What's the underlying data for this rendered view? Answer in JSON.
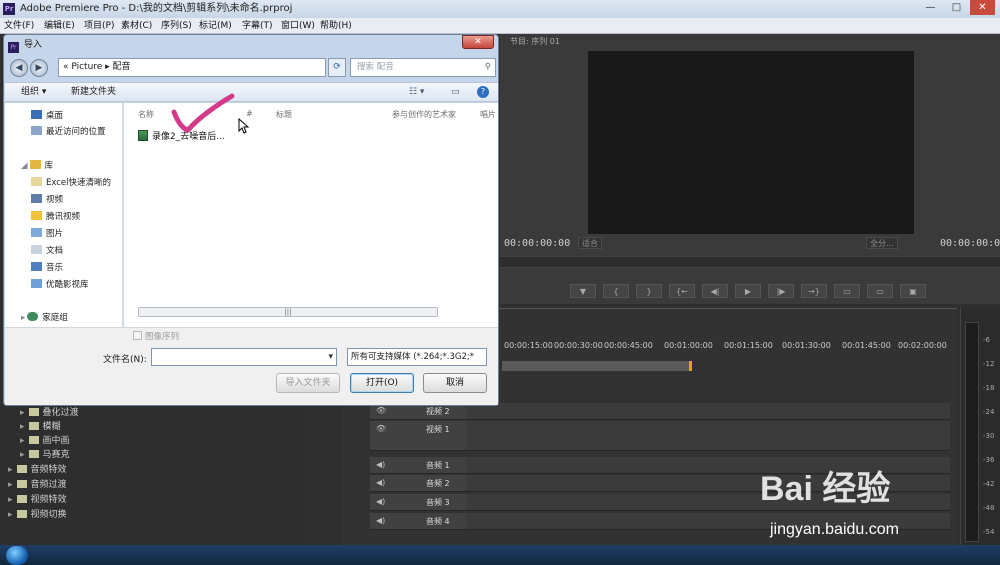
{
  "app": {
    "title": "Adobe Premiere Pro - D:\\我的文档\\剪辑系列\\未命名.prproj",
    "icon": "Pr",
    "window_controls": [
      "—",
      "□",
      "✕"
    ]
  },
  "menu": [
    "文件(F)",
    "编辑(E)",
    "项目(P)",
    "素材(C)",
    "序列(S)",
    "标记(M)",
    "字幕(T)",
    "窗口(W)",
    "帮助(H)"
  ],
  "monitor": {
    "tab": "节目: 序列 01",
    "timecode_left": "00:00:00:00",
    "fit_label": "适合",
    "full_label": "全分...",
    "timecode_right": "00:00:00:00",
    "controls": [
      "▼",
      "{",
      "}",
      "{←",
      "◀|",
      "▶",
      "|▶",
      "→}",
      "▭",
      "▭",
      "▣"
    ]
  },
  "timeline": {
    "ruler": [
      "00:00:15:00",
      "00:00:30:00",
      "00:00:45:00",
      "00:01:00:00",
      "00:01:15:00",
      "00:01:30:00",
      "00:01:45:00",
      "00:02:00:00"
    ],
    "tracks": [
      {
        "label": "视频 2",
        "icon": "👁"
      },
      {
        "label": "视频 1",
        "icon": "👁"
      },
      {
        "label": "音频 1",
        "icon": "◀)"
      },
      {
        "label": "音频 2",
        "icon": "◀)"
      },
      {
        "label": "音频 3",
        "icon": "◀)"
      },
      {
        "label": "音频 4",
        "icon": "◀)"
      }
    ]
  },
  "audio_meter": [
    "-6",
    "-12",
    "-18",
    "-24",
    "-30",
    "-36",
    "-42",
    "-48",
    "-54"
  ],
  "effects_tree": [
    {
      "label": "叠化过渡",
      "level": 1
    },
    {
      "label": "模糊",
      "level": 1
    },
    {
      "label": "画中画",
      "level": 1
    },
    {
      "label": "马赛克",
      "level": 1
    },
    {
      "label": "音频特效",
      "level": 0
    },
    {
      "label": "音频过渡",
      "level": 0
    },
    {
      "label": "视频特效",
      "level": 0
    },
    {
      "label": "视频切换",
      "level": 0
    }
  ],
  "dialog": {
    "title": "导入",
    "close": "✕",
    "breadcrumb": "« Picture ▸ 配音",
    "search_placeholder": "搜索 配音",
    "toolbar": {
      "organize": "组织 ▾",
      "new_folder": "新建文件夹"
    },
    "nav": [
      {
        "label": "桌面",
        "type": "desktop"
      },
      {
        "label": "最近访问的位置",
        "type": "recent"
      },
      {
        "label": "库",
        "type": "library"
      },
      {
        "label": "Excel快速清晰的",
        "type": "lib"
      },
      {
        "label": "视频",
        "type": "lib"
      },
      {
        "label": "腾讯视频",
        "type": "lib"
      },
      {
        "label": "图片",
        "type": "lib"
      },
      {
        "label": "文档",
        "type": "lib"
      },
      {
        "label": "音乐",
        "type": "lib"
      },
      {
        "label": "优酷影视库",
        "type": "lib"
      },
      {
        "label": "家庭组",
        "type": "homegroup"
      }
    ],
    "columns": [
      "名称",
      "#",
      "标题",
      "参与创作的艺术家",
      "唱片"
    ],
    "files": [
      {
        "name": "录像2_去噪音后..."
      }
    ],
    "image_sequence_label": "图像序列",
    "filename_label": "文件名(N):",
    "filename_value": "",
    "filetype_value": "所有可支持媒体 (*.264;*.3G2;*",
    "buttons": {
      "import_folder": "导入文件夹",
      "open": "打开(O)",
      "cancel": "取消"
    },
    "scrollbar_grip": "|||"
  },
  "watermark": {
    "logo": "Bai 经验",
    "url": "jingyan.baidu.com"
  },
  "colors": {
    "accent": "#e8a020",
    "checkmark": "#d43a8a"
  }
}
